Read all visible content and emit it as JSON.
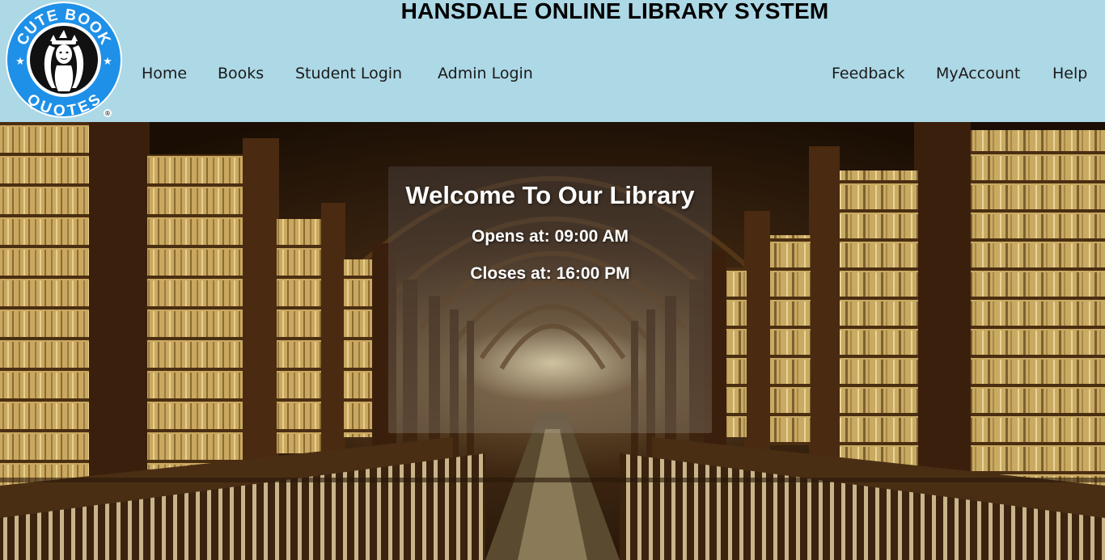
{
  "header": {
    "title": "HANSDALE ONLINE LIBRARY SYSTEM",
    "logo": {
      "top_text": "CUTE BOOK",
      "bottom_text": "QUOTES",
      "registered_mark": "®"
    },
    "nav_left": [
      {
        "label": "Home"
      },
      {
        "label": "Books"
      },
      {
        "label": "Student Login"
      },
      {
        "label": "Admin Login"
      }
    ],
    "nav_right": [
      {
        "label": "Feedback"
      },
      {
        "label": "MyAccount"
      },
      {
        "label": "Help"
      }
    ]
  },
  "hero": {
    "image": "library-hall-photo",
    "welcome": "Welcome To Our Library",
    "opens": "Opens at: 09:00 AM",
    "closes": "Closes at: 16:00 PM"
  },
  "colors": {
    "header_bg": "#add8e6",
    "logo_blue": "#1e90e8",
    "text_dark": "#1a1a1a"
  }
}
